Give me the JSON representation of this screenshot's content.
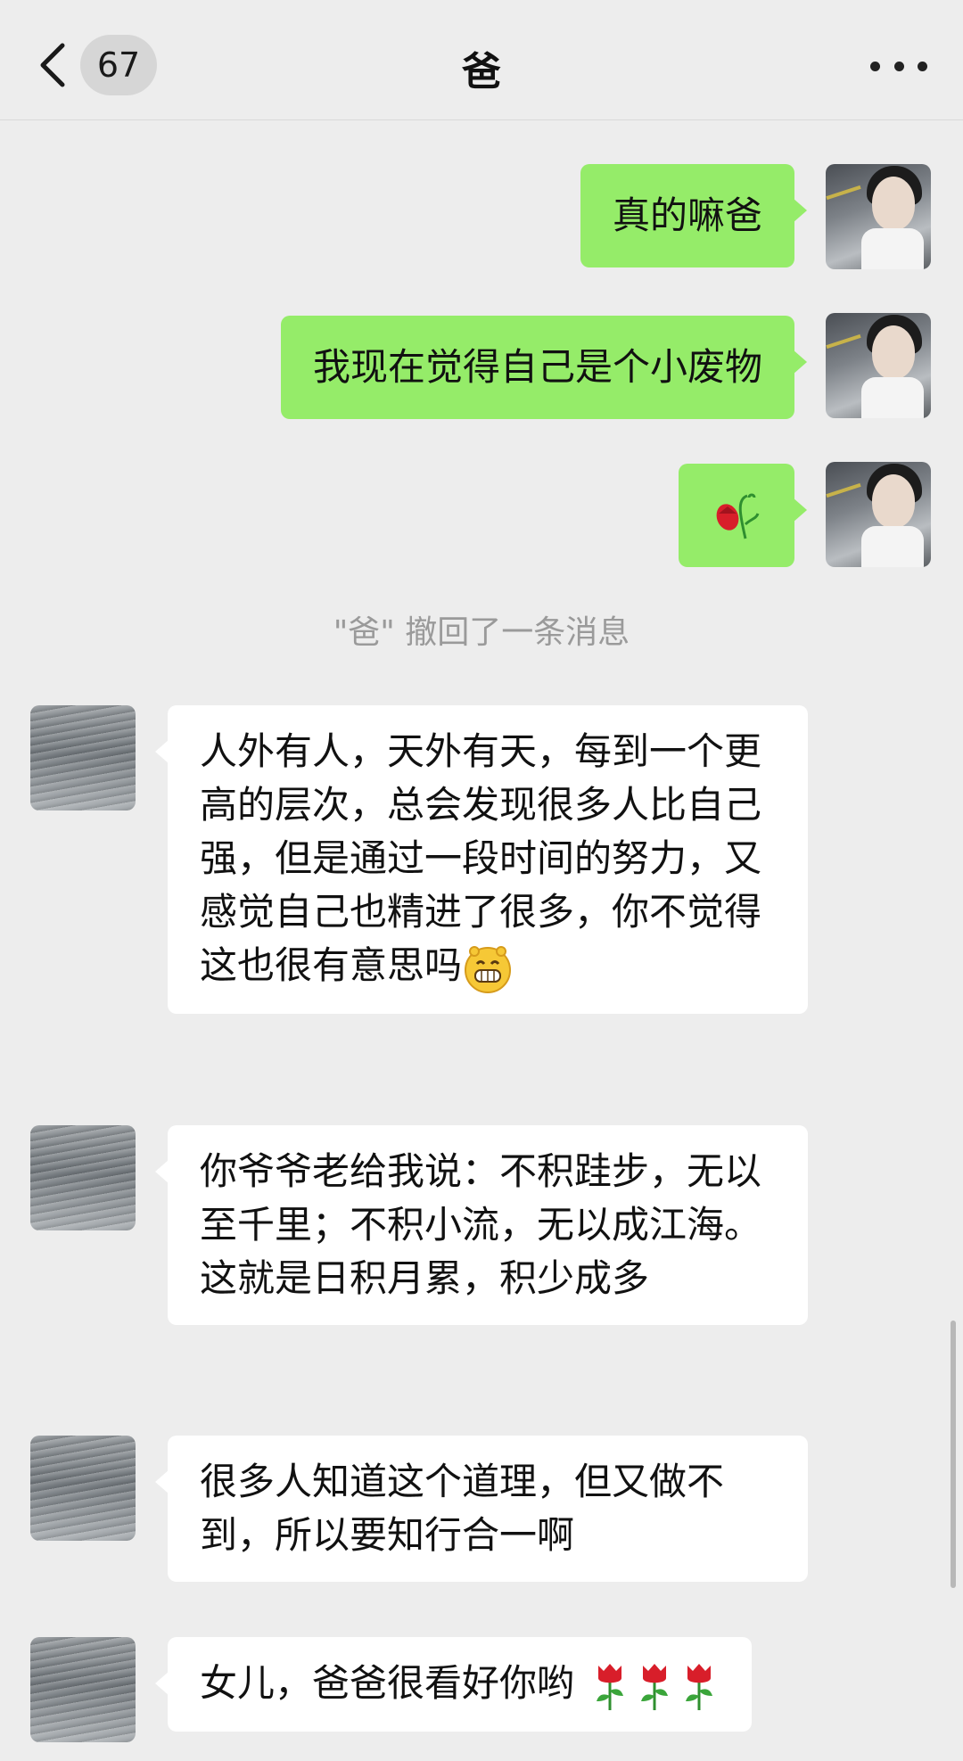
{
  "header": {
    "back_icon": "chevron-left-icon",
    "unread_count": "67",
    "title": "爸",
    "more_icon": "more-dots-icon"
  },
  "messages": [
    {
      "sender": "me",
      "text": "真的嘛爸"
    },
    {
      "sender": "me",
      "text": "我现在觉得自己是个小废物"
    },
    {
      "sender": "me",
      "emoji": "wilted-flower-emoji"
    },
    {
      "system": "\"爸\" 撤回了一条消息"
    },
    {
      "sender": "other",
      "text": "人外有人，天外有天，每到一个更高的层次，总会发现很多人比自己强，但是通过一段时间的努力，又感觉自己也精进了很多，你不觉得这也很有意思吗",
      "emoji": "grin-emoji"
    },
    {
      "sender": "other",
      "text": "你爷爷老给我说：不积跬步，无以至千里；不积小流，无以成江海。这就是日积月累，积少成多"
    },
    {
      "sender": "other",
      "text": "很多人知道这个道理，但又做不到，所以要知行合一啊"
    },
    {
      "sender": "other",
      "text": "女儿，爸爸很看好你哟",
      "emoji": "rose-emoji",
      "emoji_count": 3
    }
  ],
  "colors": {
    "background": "#ededed",
    "my_bubble": "#95ec69",
    "other_bubble": "#ffffff",
    "system_text": "#9a9a9a"
  }
}
